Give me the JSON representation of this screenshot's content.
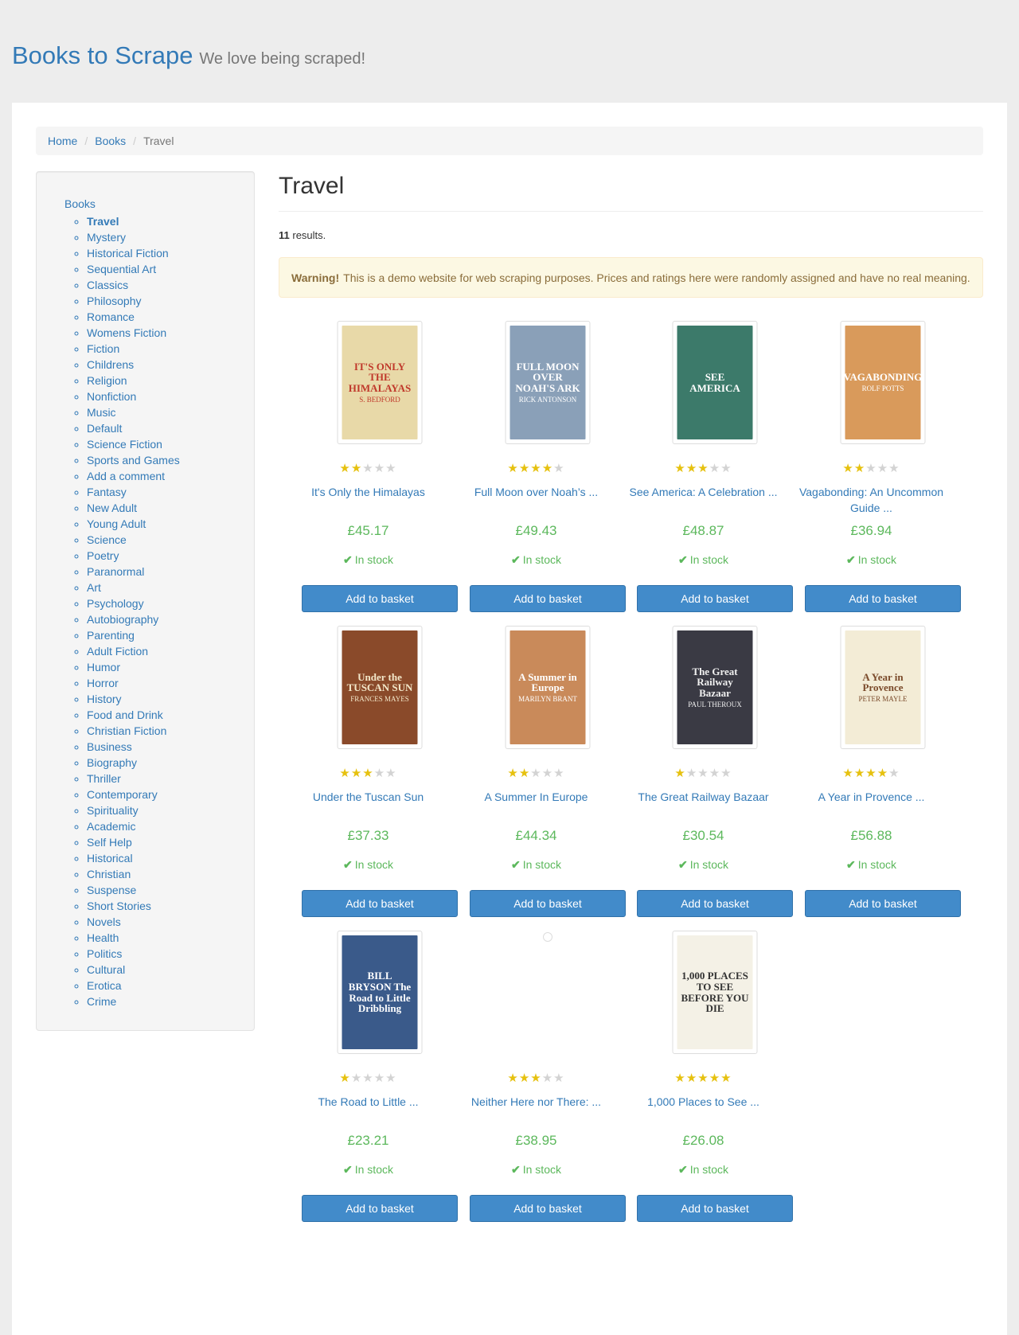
{
  "header": {
    "title": "Books to Scrape",
    "tagline": "We love being scraped!"
  },
  "breadcrumb": {
    "home": "Home",
    "books": "Books",
    "current": "Travel"
  },
  "sidebar": {
    "root": "Books",
    "categories": [
      "Travel",
      "Mystery",
      "Historical Fiction",
      "Sequential Art",
      "Classics",
      "Philosophy",
      "Romance",
      "Womens Fiction",
      "Fiction",
      "Childrens",
      "Religion",
      "Nonfiction",
      "Music",
      "Default",
      "Science Fiction",
      "Sports and Games",
      "Add a comment",
      "Fantasy",
      "New Adult",
      "Young Adult",
      "Science",
      "Poetry",
      "Paranormal",
      "Art",
      "Psychology",
      "Autobiography",
      "Parenting",
      "Adult Fiction",
      "Humor",
      "Horror",
      "History",
      "Food and Drink",
      "Christian Fiction",
      "Business",
      "Biography",
      "Thriller",
      "Contemporary",
      "Spirituality",
      "Academic",
      "Self Help",
      "Historical",
      "Christian",
      "Suspense",
      "Short Stories",
      "Novels",
      "Health",
      "Politics",
      "Cultural",
      "Erotica",
      "Crime"
    ]
  },
  "main": {
    "heading": "Travel",
    "results_count": "11",
    "results_label": "results.",
    "warning_strong": "Warning!",
    "warning_text": "This is a demo website for web scraping purposes. Prices and ratings here were randomly assigned and have no real meaning."
  },
  "products": [
    {
      "title": "It's Only the Himalayas",
      "rating": 2,
      "price": "£45.17",
      "stock": "In stock",
      "button": "Add to basket",
      "cover": {
        "bg": "#e8d9a8",
        "fg": "#c0392b",
        "text": "IT'S ONLY THE HIMALAYAS",
        "sub": "S. BEDFORD"
      }
    },
    {
      "title": "Full Moon over Noah’s ...",
      "rating": 4,
      "price": "£49.43",
      "stock": "In stock",
      "button": "Add to basket",
      "cover": {
        "bg": "#8aa0b8",
        "fg": "#ffffff",
        "text": "FULL MOON OVER NOAH'S ARK",
        "sub": "RICK ANTONSON"
      }
    },
    {
      "title": "See America: A Celebration ...",
      "rating": 3,
      "price": "£48.87",
      "stock": "In stock",
      "button": "Add to basket",
      "cover": {
        "bg": "#3c7a6a",
        "fg": "#ffffff",
        "text": "SEE AMERICA",
        "sub": ""
      }
    },
    {
      "title": "Vagabonding: An Uncommon Guide ...",
      "rating": 2,
      "price": "£36.94",
      "stock": "In stock",
      "button": "Add to basket",
      "cover": {
        "bg": "#d99a5b",
        "fg": "#ffffff",
        "text": "VAGABONDING",
        "sub": "ROLF POTTS"
      }
    },
    {
      "title": "Under the Tuscan Sun",
      "rating": 3,
      "price": "£37.33",
      "stock": "In stock",
      "button": "Add to basket",
      "cover": {
        "bg": "#8a4a2a",
        "fg": "#f3e7c9",
        "text": "Under the TUSCAN SUN",
        "sub": "FRANCES MAYES"
      }
    },
    {
      "title": "A Summer In Europe",
      "rating": 2,
      "price": "£44.34",
      "stock": "In stock",
      "button": "Add to basket",
      "cover": {
        "bg": "#c98a5a",
        "fg": "#ffffff",
        "text": "A Summer in Europe",
        "sub": "MARILYN BRANT"
      }
    },
    {
      "title": "The Great Railway Bazaar",
      "rating": 1,
      "price": "£30.54",
      "stock": "In stock",
      "button": "Add to basket",
      "cover": {
        "bg": "#3a3a44",
        "fg": "#f0f0f0",
        "text": "The Great Railway Bazaar",
        "sub": "PAUL THEROUX"
      }
    },
    {
      "title": "A Year in Provence ...",
      "rating": 4,
      "price": "£56.88",
      "stock": "In stock",
      "button": "Add to basket",
      "cover": {
        "bg": "#f3ecd6",
        "fg": "#7a4a2a",
        "text": "A Year in Provence",
        "sub": "PETER MAYLE"
      }
    },
    {
      "title": "The Road to Little ...",
      "rating": 1,
      "price": "£23.21",
      "stock": "In stock",
      "button": "Add to basket",
      "cover": {
        "bg": "#3a5a8a",
        "fg": "#ffffff",
        "text": "BILL BRYSON The Road to Little Dribbling",
        "sub": ""
      }
    },
    {
      "title": "Neither Here nor There: ...",
      "rating": 3,
      "price": "£38.95",
      "stock": "In stock",
      "button": "Add to basket",
      "cover": null
    },
    {
      "title": "1,000 Places to See ...",
      "rating": 5,
      "price": "£26.08",
      "stock": "In stock",
      "button": "Add to basket",
      "cover": {
        "bg": "#f4f1e6",
        "fg": "#333333",
        "text": "1,000 PLACES TO SEE BEFORE YOU DIE",
        "sub": ""
      }
    }
  ],
  "colors": {
    "link": "#337ab7",
    "price": "#5cb85c",
    "button": "#428bca",
    "star_on": "#e6c10f",
    "star_off": "#d3d3d3"
  }
}
